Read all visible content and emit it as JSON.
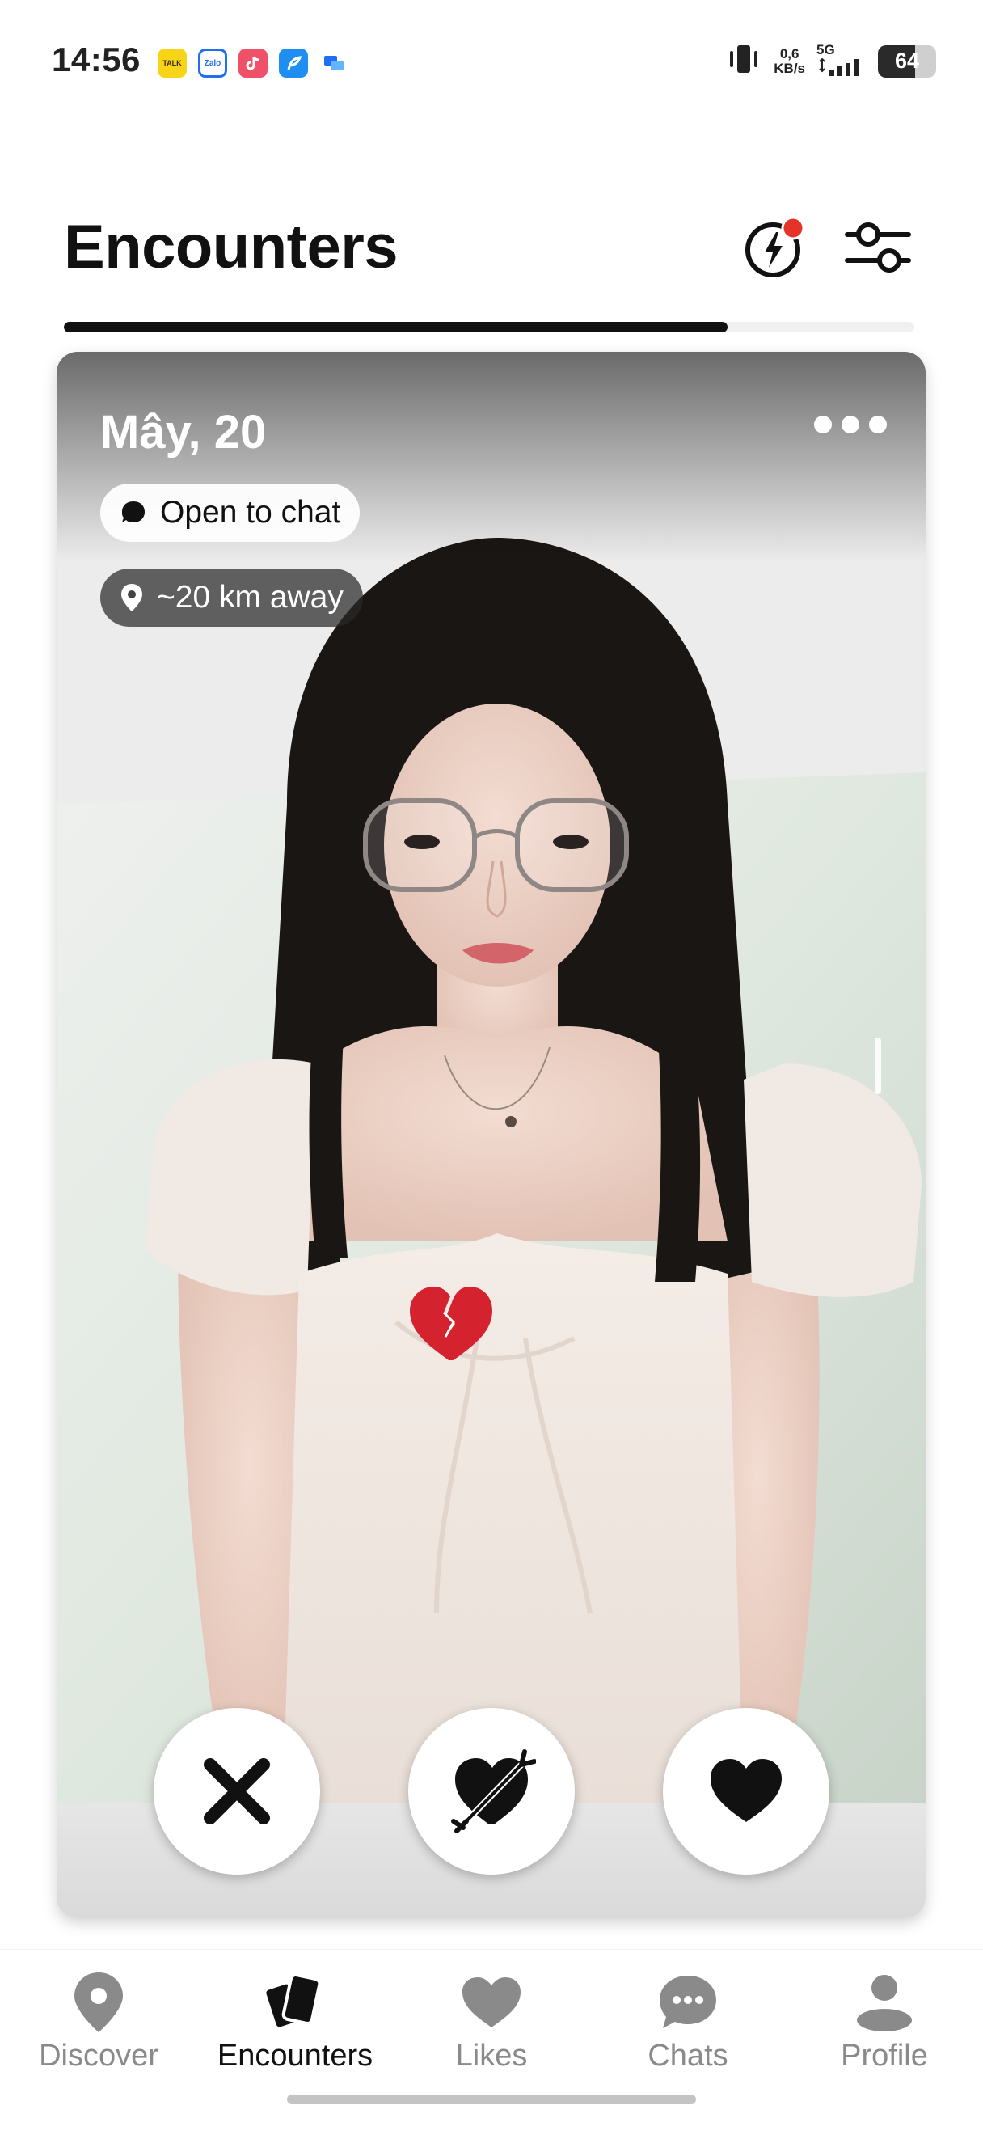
{
  "status_bar": {
    "time": "14:56",
    "network_speed": "0,6",
    "network_speed_unit": "KB/s",
    "network_type": "5G",
    "battery": "64",
    "battery_fraction": 0.64,
    "notification_icons": [
      "kakaotalk-icon",
      "zalo-icon",
      "tiktok-icon",
      "feather-app-icon",
      "messenger-icon"
    ],
    "talk_label": "TALK",
    "zalo_label": "Zalo"
  },
  "header": {
    "title": "Encounters",
    "boost_icon": "lightning-icon",
    "filter_icon": "sliders-icon",
    "boost_badge_color": "#e5332a"
  },
  "progress": {
    "fraction": 0.78
  },
  "card": {
    "name_age": "Mây, 20",
    "chat_status": "Open to chat",
    "distance": "~20 km away",
    "photo_overlay_icon": "broken-heart-icon",
    "actions": {
      "pass_icon": "close-icon",
      "crush_icon": "crush-heart-arrow-icon",
      "like_icon": "heart-icon"
    }
  },
  "bottom_nav": {
    "items": [
      {
        "label": "Discover",
        "icon": "location-pin-icon",
        "active": false
      },
      {
        "label": "Encounters",
        "icon": "cards-icon",
        "active": true
      },
      {
        "label": "Likes",
        "icon": "heart-icon",
        "active": false
      },
      {
        "label": "Chats",
        "icon": "chat-bubble-icon",
        "active": false
      },
      {
        "label": "Profile",
        "icon": "person-icon",
        "active": false
      }
    ]
  },
  "colors": {
    "text_primary": "#111111",
    "nav_inactive": "#8a8a8a",
    "progress_fill": "#111111"
  }
}
